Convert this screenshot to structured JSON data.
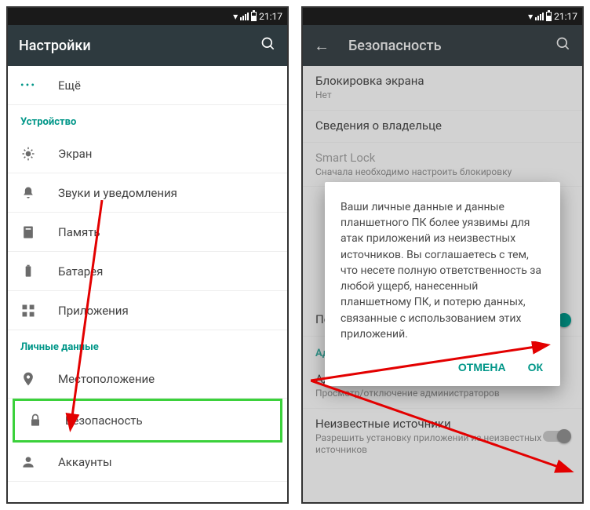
{
  "status": {
    "time": "21:17"
  },
  "phone1": {
    "title": "Настройки",
    "more_label": "Ещё",
    "section_device": "Устройство",
    "items_device": [
      {
        "label": "Экран"
      },
      {
        "label": "Звуки и уведомления"
      },
      {
        "label": "Память"
      },
      {
        "label": "Батарея"
      },
      {
        "label": "Приложения"
      }
    ],
    "section_personal": "Личные данные",
    "items_personal": [
      {
        "label": "Местоположение"
      },
      {
        "label": "Безопасность"
      },
      {
        "label": "Аккаунты"
      }
    ]
  },
  "phone2": {
    "title": "Безопасность",
    "screen_lock_title": "Блокировка экрана",
    "screen_lock_sub": "Нет",
    "owner_info": "Сведения о владельце",
    "smart_lock_title": "Smart Lock",
    "smart_lock_sub": "Сначала необходимо настроить блокировку",
    "section_admin": "Администрирование устройства",
    "device_admin_title": "Администраторы устройства",
    "device_admin_sub": "Просмотр/отключение администраторов",
    "unknown_title": "Неизвестные источники",
    "unknown_sub": "Разрешить установку приложений из неизвестных источников",
    "password_show": "Показывать пароль при вводе",
    "dialog": {
      "message": "Ваши личные данные и данные планшетного ПК более уязвимы для атак приложений из неизвестных источников. Вы соглашаетесь с тем, что несете полную ответственность за любой ущерб, нанесенный планшетному ПК, и потерю данных, связанные с использованием этих приложений.",
      "cancel": "ОТМЕНА",
      "ok": "ОК"
    }
  }
}
